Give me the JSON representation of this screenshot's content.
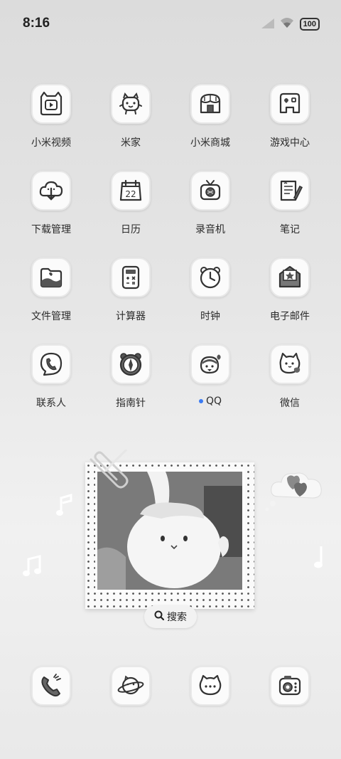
{
  "status": {
    "time": "8:16",
    "battery": "100",
    "icons": [
      "signal-icon",
      "wifi-icon",
      "battery-icon"
    ]
  },
  "apps": [
    {
      "label": "小米视频",
      "icon": "video-icon"
    },
    {
      "label": "米家",
      "icon": "robot-icon"
    },
    {
      "label": "小米商城",
      "icon": "shop-icon"
    },
    {
      "label": "游戏中心",
      "icon": "game-icon"
    },
    {
      "label": "下载管理",
      "icon": "cloud-download-icon"
    },
    {
      "label": "日历",
      "icon": "calendar-icon",
      "badge_text": "22"
    },
    {
      "label": "录音机",
      "icon": "radio-icon"
    },
    {
      "label": "笔记",
      "icon": "note-icon"
    },
    {
      "label": "文件管理",
      "icon": "folder-icon"
    },
    {
      "label": "计算器",
      "icon": "calculator-icon"
    },
    {
      "label": "时钟",
      "icon": "clock-icon"
    },
    {
      "label": "电子邮件",
      "icon": "mail-icon"
    },
    {
      "label": "联系人",
      "icon": "contact-icon"
    },
    {
      "label": "指南针",
      "icon": "compass-icon"
    },
    {
      "label": "QQ",
      "icon": "penguin-icon",
      "has_update_dot": true,
      "dot_color": "#3b7bf3"
    },
    {
      "label": "微信",
      "icon": "wechat-cat-icon"
    }
  ],
  "widget": {
    "search_label": "搜索"
  },
  "dock": [
    {
      "icon": "phone-icon"
    },
    {
      "icon": "planet-browser-icon"
    },
    {
      "icon": "message-cat-icon"
    },
    {
      "icon": "camera-icon"
    }
  ]
}
